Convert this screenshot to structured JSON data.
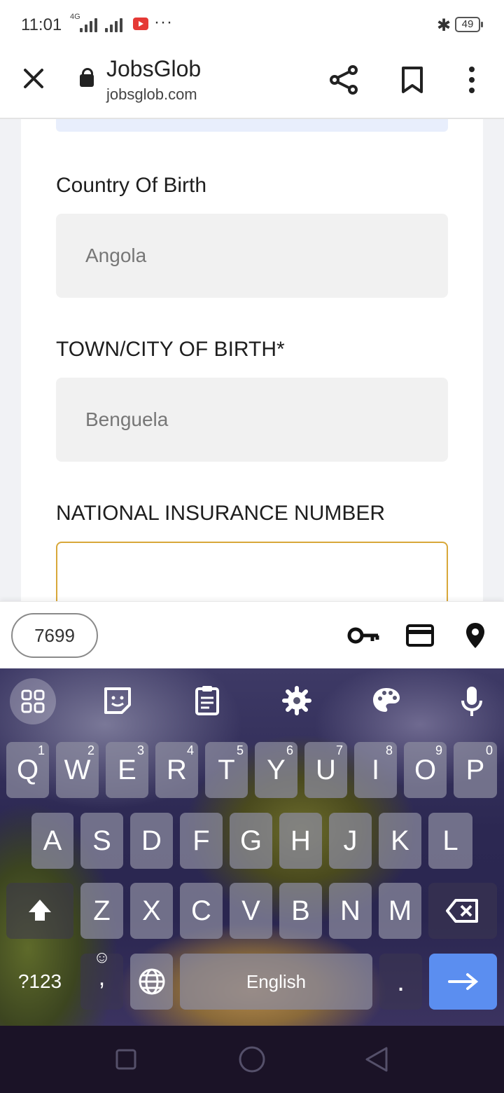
{
  "status_bar": {
    "time": "11:01",
    "network": "4G",
    "battery": "49"
  },
  "browser": {
    "site_title": "JobsGlob",
    "site_url": "jobsglob.com",
    "icons": [
      "close-icon",
      "lock-icon",
      "share-icon",
      "bookmark-icon",
      "more-vert-icon"
    ]
  },
  "form": {
    "country_label": "Country Of Birth",
    "country_value": "Angola",
    "town_label": "TOWN/CITY OF BIRTH*",
    "town_value": "Benguela",
    "ni_label": "NATIONAL INSURANCE NUMBER",
    "ni_value": ""
  },
  "autofill": {
    "suggestion": "7699",
    "icons": [
      "key-icon",
      "credit-card-icon",
      "location-pin-icon"
    ]
  },
  "keyboard": {
    "toolbar_icons": [
      "apps-grid-icon",
      "sticker-icon",
      "clipboard-icon",
      "settings-icon",
      "palette-icon",
      "microphone-icon"
    ],
    "row1": [
      {
        "k": "Q",
        "h": "1"
      },
      {
        "k": "W",
        "h": "2"
      },
      {
        "k": "E",
        "h": "3"
      },
      {
        "k": "R",
        "h": "4"
      },
      {
        "k": "T",
        "h": "5"
      },
      {
        "k": "Y",
        "h": "6"
      },
      {
        "k": "U",
        "h": "7"
      },
      {
        "k": "I",
        "h": "8"
      },
      {
        "k": "O",
        "h": "9"
      },
      {
        "k": "P",
        "h": "0"
      }
    ],
    "row2": [
      "A",
      "S",
      "D",
      "F",
      "G",
      "H",
      "J",
      "K",
      "L"
    ],
    "row3": [
      "Z",
      "X",
      "C",
      "V",
      "B",
      "N",
      "M"
    ],
    "symbols_key": "?123",
    "comma_key": ",",
    "space_label": "English",
    "period_key": ".",
    "accent_color": "#5b8ef0"
  },
  "nav_icons": [
    "recents-icon",
    "home-icon",
    "back-icon"
  ]
}
